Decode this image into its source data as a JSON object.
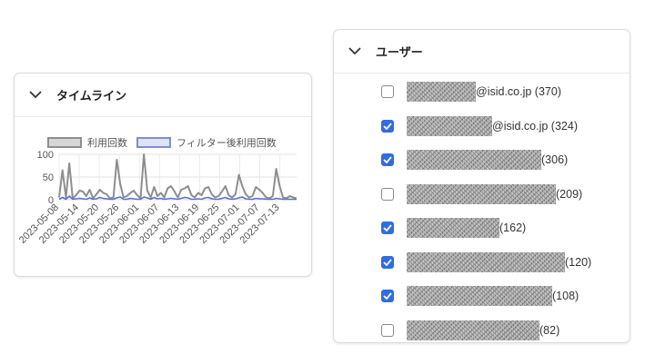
{
  "timeline": {
    "title": "タイムライン",
    "collapse_icon": "chevron-down-icon",
    "legend": [
      {
        "label": "利用回数",
        "color": "#8e8e8e"
      },
      {
        "label": "フィルター後利用回数",
        "color": "#5b6fd6"
      }
    ]
  },
  "chart_data": {
    "type": "line",
    "title": "",
    "xlabel": "",
    "ylabel": "",
    "ylim": [
      0,
      100
    ],
    "yticks": [
      "100",
      "50",
      "0"
    ],
    "xticks": [
      "2023-05-08",
      "2023-05-14",
      "2023-05-20",
      "2023-05-26",
      "2023-06-01",
      "2023-06-07",
      "2023-06-13",
      "2023-06-19",
      "2023-06-25",
      "2023-07-01",
      "2023-07-07",
      "2023-07-13"
    ],
    "x_start": "2023-05-08",
    "x_end": "2023-07-18",
    "grid": true,
    "series": [
      {
        "name": "利用回数",
        "color": "#8e8e8e",
        "values": [
          5,
          65,
          5,
          80,
          3,
          10,
          20,
          18,
          8,
          22,
          3,
          12,
          22,
          15,
          12,
          3,
          5,
          88,
          35,
          5,
          8,
          15,
          20,
          10,
          3,
          100,
          20,
          5,
          28,
          8,
          15,
          5,
          25,
          30,
          18,
          5,
          22,
          25,
          30,
          10,
          5,
          15,
          10,
          25,
          28,
          12,
          5,
          8,
          18,
          30,
          10,
          5,
          12,
          55,
          30,
          12,
          5,
          8,
          28,
          22,
          15,
          5,
          3,
          8,
          68,
          30,
          5,
          3,
          8,
          5,
          3
        ]
      },
      {
        "name": "フィルター後利用回数",
        "color": "#5b6fd6",
        "values": [
          1,
          5,
          1,
          8,
          1,
          2,
          3,
          2,
          1,
          4,
          1,
          2,
          5,
          3,
          2,
          1,
          1,
          4,
          6,
          1,
          1,
          3,
          2,
          1,
          1,
          6,
          4,
          1,
          5,
          2,
          3,
          1,
          2,
          3,
          2,
          1,
          3,
          5,
          4,
          1,
          1,
          2,
          1,
          4,
          5,
          2,
          1,
          1,
          3,
          5,
          2,
          1,
          2,
          4,
          6,
          2,
          1,
          1,
          3,
          2,
          2,
          1,
          1,
          1,
          3,
          2,
          1,
          1,
          1,
          1,
          1
        ]
      }
    ]
  },
  "users": {
    "title": "ユーザー",
    "collapse_icon": "chevron-down-icon",
    "items": [
      {
        "checked": false,
        "suffix": "@isid.co.jp (370)"
      },
      {
        "checked": true,
        "suffix": "@isid.co.jp (324)"
      },
      {
        "checked": true,
        "suffix": "(306)"
      },
      {
        "checked": false,
        "suffix": " (209)"
      },
      {
        "checked": true,
        "suffix": " (162)"
      },
      {
        "checked": true,
        "suffix": " (120)"
      },
      {
        "checked": true,
        "suffix": "(108)"
      },
      {
        "checked": false,
        "suffix": "(82)"
      }
    ]
  }
}
